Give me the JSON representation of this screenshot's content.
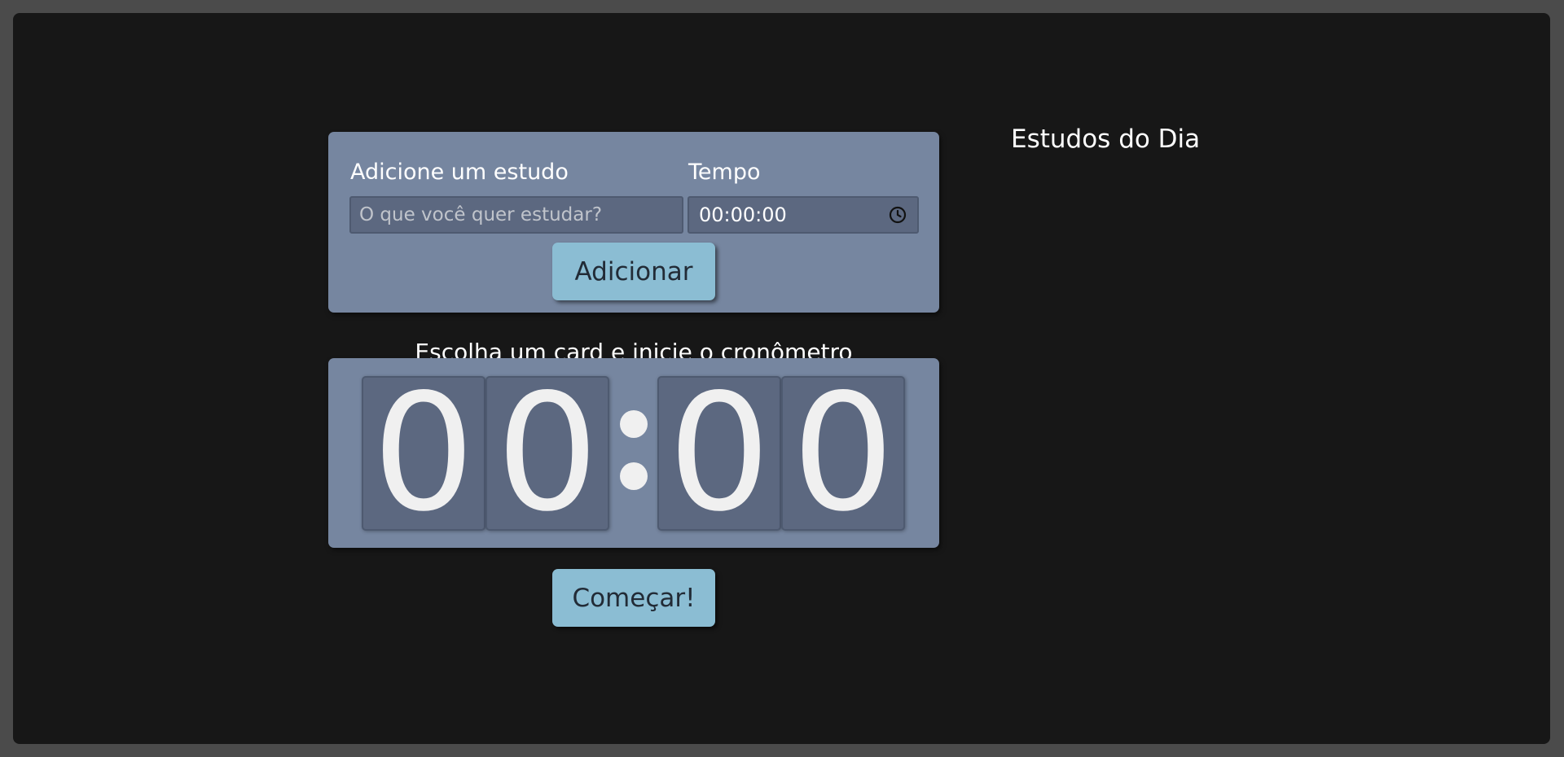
{
  "form": {
    "task_label": "Adicione um estudo",
    "task_placeholder": "O que você quer estudar?",
    "time_label": "Tempo",
    "time_value": "00:00:00",
    "time_icon": "clock-icon",
    "add_button": "Adicionar"
  },
  "timer": {
    "hint": "Escolha um card e inicie o cronômetro",
    "digits": [
      "0",
      "0",
      "0",
      "0"
    ],
    "start_button": "Começar!"
  },
  "list": {
    "title": "Estudos do Dia",
    "items": []
  },
  "colors": {
    "background": "#171717",
    "card": "#7686a0",
    "input": "#5c6880",
    "button": "#8bbdd3"
  }
}
